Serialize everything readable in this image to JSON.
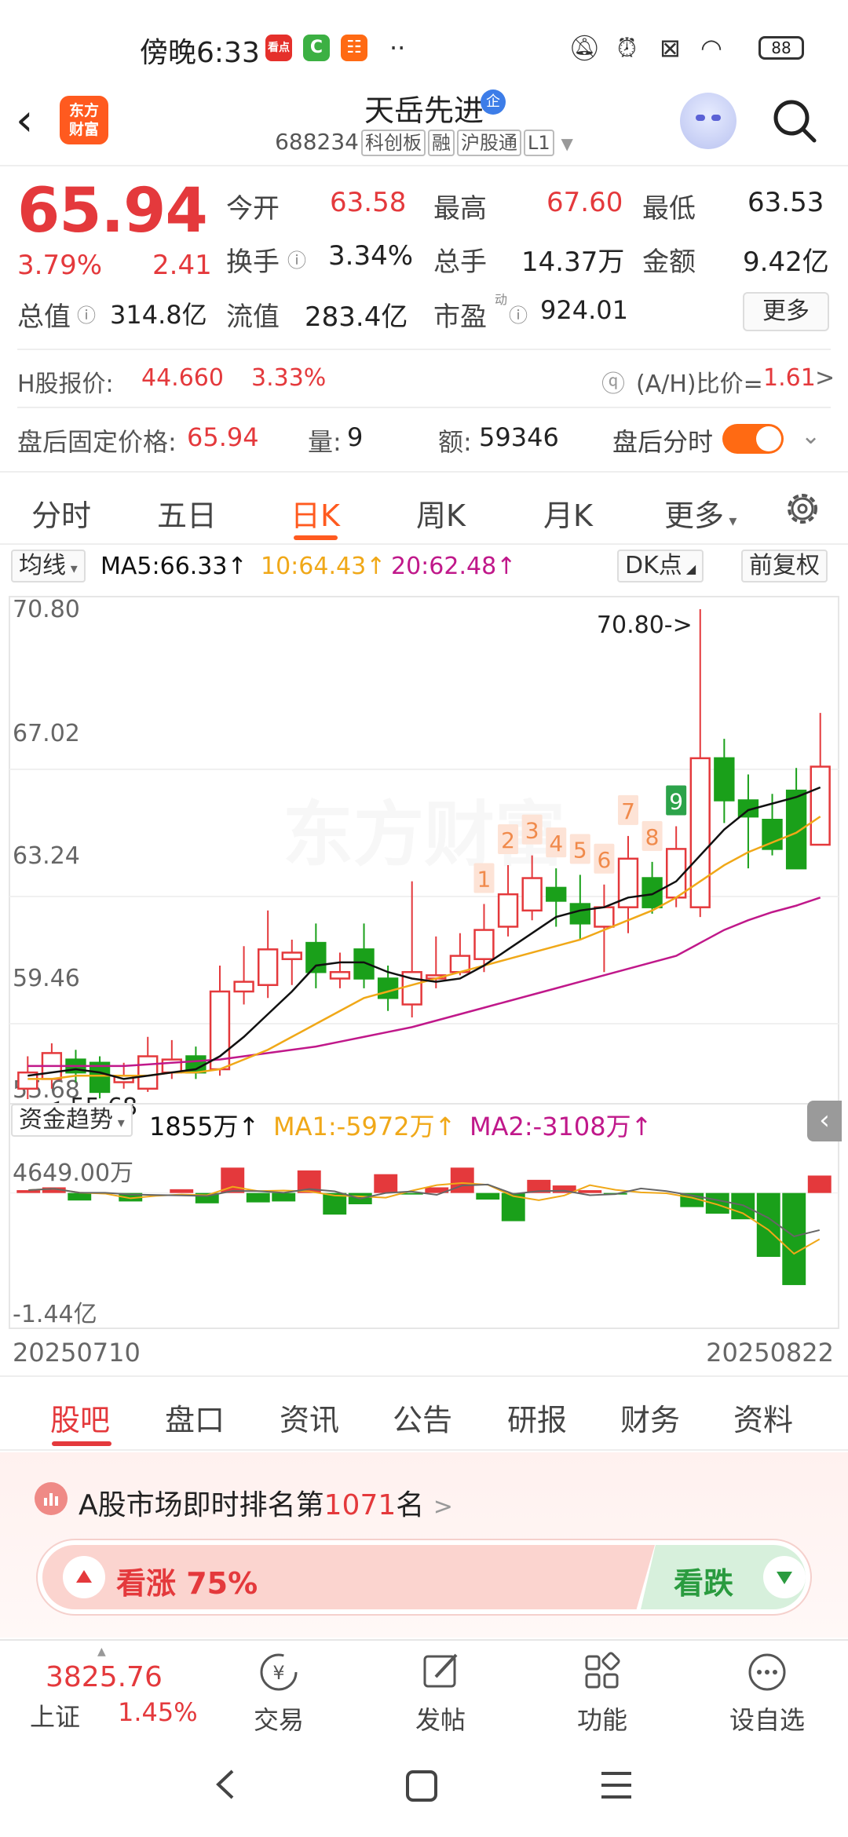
{
  "status_bar": {
    "time": "傍晚6:33",
    "battery": "88",
    "app_icons": [
      "red-news-app-icon",
      "green-c-app-icon",
      "orange-grid-app-icon"
    ]
  },
  "header": {
    "stock_name": "天岳先进",
    "badge": "企",
    "code": "688234",
    "tags": [
      "科创板",
      "融",
      "沪股通",
      "L1"
    ],
    "logo_line1": "东方",
    "logo_line2": "财富"
  },
  "quote": {
    "price": "65.94",
    "change_pct": "3.79%",
    "change_amt": "2.41",
    "open_label": "今开",
    "open": "63.58",
    "high_label": "最高",
    "high": "67.60",
    "low_label": "最低",
    "low": "63.53",
    "turnover_label": "换手",
    "turnover": "3.34%",
    "volume_label": "总手",
    "volume": "14.37万",
    "amount_label": "金额",
    "amount": "9.42亿",
    "mcap_label": "总值",
    "mcap": "314.8亿",
    "float_label": "流值",
    "float_mcap": "283.4亿",
    "pe_label": "市盈",
    "pe_sup": "动",
    "pe": "924.01",
    "more_button": "更多"
  },
  "hshare": {
    "label": "H股报价:",
    "price": "44.660",
    "pct": "3.33%",
    "ratio_label": "(A/H)比价=",
    "ratio": "1.61",
    "arrow": ">"
  },
  "after_hours": {
    "label": "盘后固定价格:",
    "price": "65.94",
    "vol_label": "量:",
    "vol": "9",
    "amt_label": "额:",
    "amt": "59346",
    "toggle_label": "盘后分时",
    "toggle_on": true
  },
  "kline_tabs": [
    "分时",
    "五日",
    "日K",
    "周K",
    "月K",
    "更多"
  ],
  "active_kline_tab": "日K",
  "ma_row": {
    "selector": "均线",
    "ma5": "MA5:66.33",
    "ma10": "10:64.43",
    "ma20": "20:62.48",
    "dk_button": "DK点",
    "adjust_button": "前复权",
    "colors": {
      "ma5": "#111111",
      "ma10": "#f0a818",
      "ma20": "#c0188a"
    }
  },
  "chart_data": {
    "type": "candlestick",
    "y_axis_labels": [
      "70.80",
      "67.02",
      "63.24",
      "59.46",
      "55.68"
    ],
    "high_annotation": "70.80->",
    "low_annotation": "<-55.68",
    "watermark": "东方财富",
    "dates": {
      "start": "20250710",
      "end": "20250822"
    },
    "ylim": [
      55.68,
      70.8
    ],
    "candles": [
      {
        "o": 56.0,
        "c": 56.5,
        "h": 57.0,
        "l": 55.68
      },
      {
        "o": 56.3,
        "c": 57.1,
        "h": 57.4,
        "l": 56.0
      },
      {
        "o": 56.9,
        "c": 56.5,
        "h": 57.2,
        "l": 56.2
      },
      {
        "o": 56.8,
        "c": 55.9,
        "h": 57.0,
        "l": 55.7
      },
      {
        "o": 56.2,
        "c": 56.4,
        "h": 56.8,
        "l": 56.0
      },
      {
        "o": 56.0,
        "c": 57.0,
        "h": 57.6,
        "l": 55.9
      },
      {
        "o": 56.5,
        "c": 56.9,
        "h": 57.5,
        "l": 56.3
      },
      {
        "o": 57.0,
        "c": 56.5,
        "h": 57.3,
        "l": 56.3
      },
      {
        "o": 56.6,
        "c": 59.0,
        "h": 59.8,
        "l": 56.4
      },
      {
        "o": 59.0,
        "c": 59.3,
        "h": 60.4,
        "l": 58.6
      },
      {
        "o": 59.2,
        "c": 60.3,
        "h": 61.5,
        "l": 58.8
      },
      {
        "o": 60.0,
        "c": 60.2,
        "h": 60.6,
        "l": 59.2
      },
      {
        "o": 60.5,
        "c": 59.6,
        "h": 61.1,
        "l": 59.1
      },
      {
        "o": 59.4,
        "c": 59.6,
        "h": 60.2,
        "l": 59.1
      },
      {
        "o": 60.3,
        "c": 59.4,
        "h": 61.1,
        "l": 59.1
      },
      {
        "o": 59.4,
        "c": 58.8,
        "h": 59.8,
        "l": 58.4
      },
      {
        "o": 58.6,
        "c": 59.6,
        "h": 62.4,
        "l": 58.2
      },
      {
        "o": 59.4,
        "c": 59.5,
        "h": 60.7,
        "l": 59.1
      },
      {
        "o": 59.6,
        "c": 60.1,
        "h": 60.8,
        "l": 59.5
      },
      {
        "o": 60.0,
        "c": 60.9,
        "h": 61.7,
        "l": 59.6
      },
      {
        "o": 61.0,
        "c": 62.0,
        "h": 62.9,
        "l": 60.7
      },
      {
        "o": 61.5,
        "c": 62.5,
        "h": 63.2,
        "l": 61.2
      },
      {
        "o": 62.2,
        "c": 61.8,
        "h": 62.8,
        "l": 61.0
      },
      {
        "o": 61.7,
        "c": 61.1,
        "h": 62.6,
        "l": 60.6
      },
      {
        "o": 61.0,
        "c": 61.6,
        "h": 62.3,
        "l": 59.6
      },
      {
        "o": 61.6,
        "c": 63.1,
        "h": 63.8,
        "l": 60.8
      },
      {
        "o": 62.5,
        "c": 61.6,
        "h": 63.0,
        "l": 61.4
      },
      {
        "o": 61.9,
        "c": 63.4,
        "h": 64.1,
        "l": 61.6
      },
      {
        "o": 61.6,
        "c": 66.2,
        "h": 70.8,
        "l": 61.3
      },
      {
        "o": 66.2,
        "c": 64.9,
        "h": 66.8,
        "l": 64.2
      },
      {
        "o": 64.9,
        "c": 64.4,
        "h": 65.7,
        "l": 62.8
      },
      {
        "o": 64.3,
        "c": 63.4,
        "h": 65.1,
        "l": 63.2
      },
      {
        "o": 65.2,
        "c": 62.8,
        "h": 65.9,
        "l": 62.8
      },
      {
        "o": 63.53,
        "c": 65.94,
        "h": 67.6,
        "l": 63.53
      }
    ],
    "ma5_line": [
      56.4,
      56.5,
      56.6,
      56.5,
      56.3,
      56.4,
      56.5,
      56.6,
      57.0,
      57.6,
      58.3,
      59.0,
      59.8,
      59.9,
      59.9,
      59.6,
      59.4,
      59.3,
      59.4,
      59.8,
      60.3,
      60.8,
      61.3,
      61.5,
      61.6,
      61.9,
      62.0,
      62.4,
      63.2,
      64.0,
      64.6,
      64.8,
      65.0,
      65.3
    ],
    "ma10_line": [
      56.3,
      56.3,
      56.4,
      56.4,
      56.4,
      56.4,
      56.5,
      56.5,
      56.6,
      56.9,
      57.2,
      57.6,
      58.0,
      58.4,
      58.8,
      59.0,
      59.2,
      59.4,
      59.6,
      59.8,
      60.0,
      60.2,
      60.4,
      60.6,
      60.9,
      61.2,
      61.5,
      61.9,
      62.4,
      62.9,
      63.3,
      63.6,
      63.9,
      64.4
    ],
    "ma20_line": [
      56.7,
      56.7,
      56.7,
      56.7,
      56.7,
      56.75,
      56.8,
      56.85,
      56.9,
      57.0,
      57.1,
      57.2,
      57.3,
      57.45,
      57.6,
      57.75,
      57.9,
      58.1,
      58.3,
      58.5,
      58.7,
      58.9,
      59.1,
      59.3,
      59.5,
      59.7,
      59.9,
      60.1,
      60.5,
      60.9,
      61.2,
      61.45,
      61.65,
      61.9
    ],
    "nine_turn_labels": [
      {
        "index": 19,
        "label": "1"
      },
      {
        "index": 20,
        "label": "2"
      },
      {
        "index": 21,
        "label": "3"
      },
      {
        "index": 22,
        "label": "4"
      },
      {
        "index": 23,
        "label": "5"
      },
      {
        "index": 24,
        "label": "6"
      },
      {
        "index": 25,
        "label": "7"
      },
      {
        "index": 26,
        "label": "8"
      },
      {
        "index": 27,
        "label": "9"
      }
    ],
    "fund_flow": {
      "title": "资金趋势",
      "value": "1855万",
      "ma1": "MA1:-5972万",
      "ma2": "MA2:-3108万",
      "y_labels": [
        "4649.00万",
        "-1.44亿"
      ],
      "bars": [
        300,
        600,
        -800,
        0,
        -900,
        0,
        400,
        -1100,
        2700,
        -1000,
        -900,
        2400,
        -2300,
        -1200,
        2000,
        -100,
        600,
        2700,
        -700,
        -3000,
        1400,
        800,
        300,
        -100,
        0,
        0,
        -1500,
        -2200,
        -2800,
        -6800,
        -9800,
        1855
      ],
      "ylim": [
        -14400,
        4649
      ]
    }
  },
  "news_tabs": [
    "股吧",
    "盘口",
    "资讯",
    "公告",
    "研报",
    "财务",
    "资料"
  ],
  "active_news_tab": "股吧",
  "ranking": {
    "prefix": "A股市场即时排名第",
    "rank": "1071",
    "suffix": "名",
    "arrow": ">",
    "up_label": "看涨 75%",
    "up_fraction": 0.75,
    "down_label": "看跌"
  },
  "bottom_toolbar": {
    "index_value": "3825.76",
    "index_name": "上证",
    "index_pct": "1.45%",
    "items": [
      "交易",
      "发帖",
      "功能",
      "设自选"
    ]
  }
}
